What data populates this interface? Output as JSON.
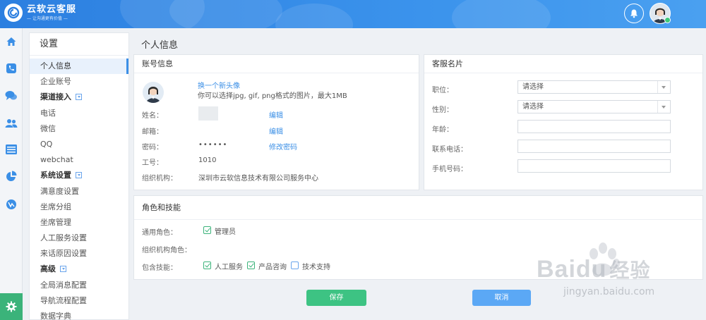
{
  "app": {
    "title": "云软云客服",
    "subtitle": "— 让沟通更有价值 —"
  },
  "header": {
    "bell_icon": "bell-icon",
    "avatar_icon": "agent-avatar-icon",
    "status_color": "#3cc97a"
  },
  "rail": {
    "items": [
      "home-icon",
      "phone-icon",
      "chat-icon",
      "users-icon",
      "list-icon",
      "pie-chart-icon",
      "analytics-icon"
    ],
    "settings_icon": "gear-icon",
    "settings_color": "#3bb37a"
  },
  "menu": {
    "title": "设置",
    "items": [
      {
        "label": "个人信息",
        "type": "item",
        "active": true
      },
      {
        "label": "企业账号",
        "type": "item"
      },
      {
        "label": "渠道接入",
        "type": "group"
      },
      {
        "label": "电话",
        "type": "item"
      },
      {
        "label": "微信",
        "type": "item"
      },
      {
        "label": "QQ",
        "type": "item"
      },
      {
        "label": "webchat",
        "type": "item"
      },
      {
        "label": "系统设置",
        "type": "group"
      },
      {
        "label": "满意度设置",
        "type": "item"
      },
      {
        "label": "坐席分组",
        "type": "item"
      },
      {
        "label": "坐席管理",
        "type": "item"
      },
      {
        "label": "人工服务设置",
        "type": "item"
      },
      {
        "label": "来话原因设置",
        "type": "item"
      },
      {
        "label": "高级",
        "type": "group"
      },
      {
        "label": "全局消息配置",
        "type": "item"
      },
      {
        "label": "导航流程配置",
        "type": "item"
      },
      {
        "label": "数据字典",
        "type": "item"
      }
    ]
  },
  "page": {
    "title": "个人信息"
  },
  "account": {
    "title": "账号信息",
    "change_avatar": "换一个新头像",
    "avatar_hint": "你可以选择jpg, gif, png格式的图片，最大1MB",
    "name_label": "姓名：",
    "email_label": "邮箱：",
    "password_label": "密码：",
    "password_value": "••••••",
    "employee_label": "工号：",
    "employee_value": "1010",
    "org_label": "组织机构：",
    "org_value": "深圳市云软信息技术有限公司服务中心",
    "edit_label": "编辑",
    "change_password": "修改密码"
  },
  "card": {
    "title": "客服名片",
    "position_label": "职位：",
    "position_value": "请选择",
    "gender_label": "性别：",
    "gender_value": "请选择",
    "age_label": "年龄：",
    "age_value": "",
    "contact_label": "联系电话：",
    "contact_value": "",
    "mobile_label": "手机号码：",
    "mobile_value": ""
  },
  "roles": {
    "title": "角色和技能",
    "general_label": "通用角色：",
    "general_option": "管理员",
    "general_checked": true,
    "org_role_label": "组织机构角色：",
    "skills_label": "包含技能：",
    "skills": [
      {
        "label": "人工服务",
        "checked": true
      },
      {
        "label": "产品咨询",
        "checked": true
      },
      {
        "label": "技术支持",
        "checked": false
      }
    ]
  },
  "actions": {
    "save": "保存",
    "cancel": "取消",
    "save_color": "#3dc383",
    "cancel_color": "#5ba8f5"
  },
  "watermark": {
    "brand": "Baidu",
    "brand_cn": "经验",
    "url": "jingyan.baidu.com"
  }
}
